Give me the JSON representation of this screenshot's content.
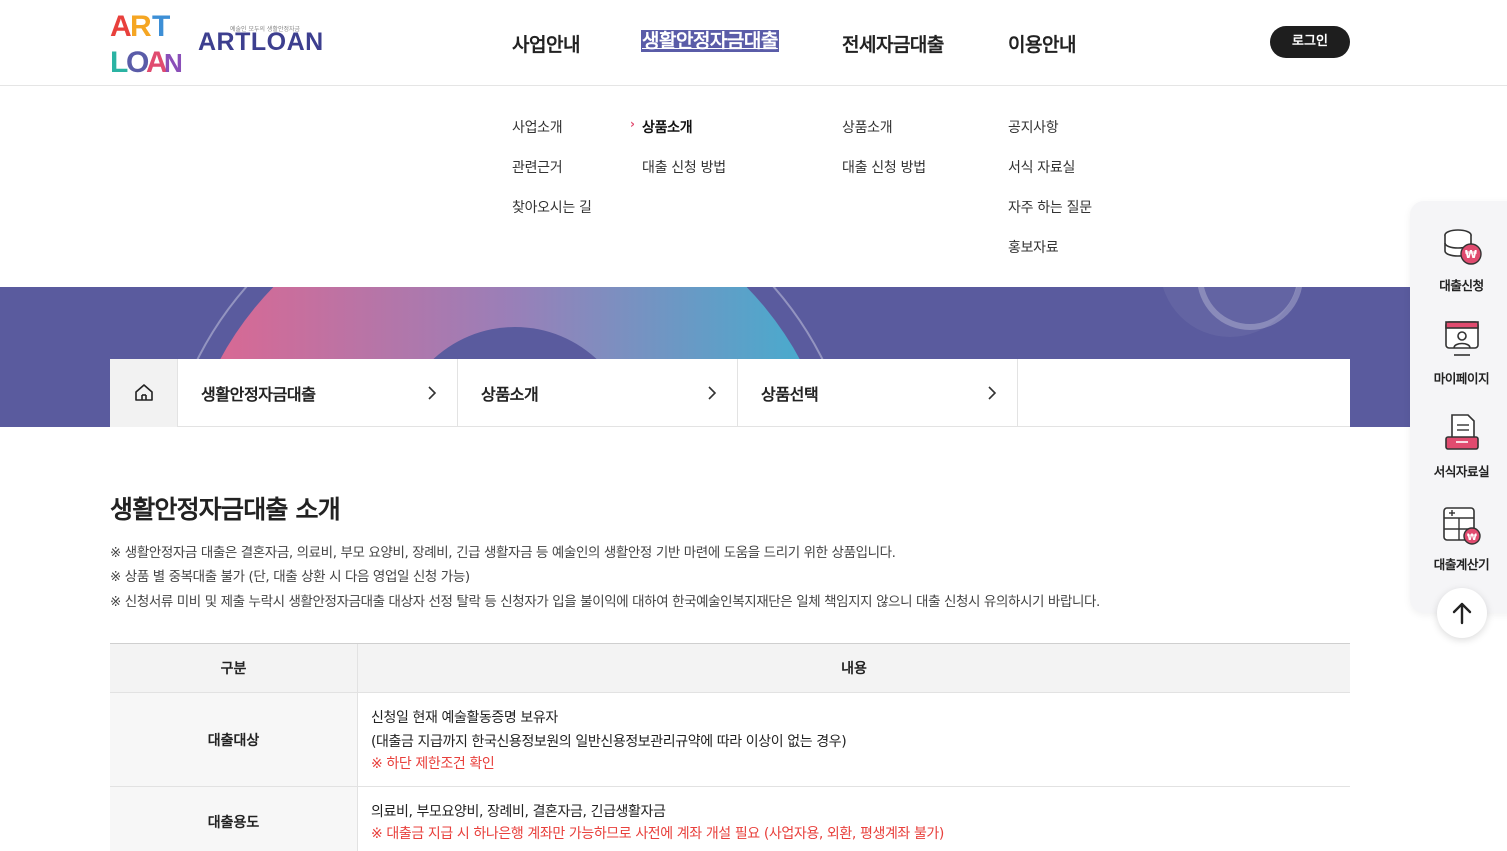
{
  "logo": {
    "tagline": "예술인 모두의 생활안정자금",
    "name": "ARTLOAN"
  },
  "gnb": [
    {
      "label": "사업안내"
    },
    {
      "label": "생활안정자금대출"
    },
    {
      "label": "전세자금대출"
    },
    {
      "label": "이용안내"
    }
  ],
  "login_label": "로그인",
  "submenu": {
    "col1": [
      "사업소개",
      "관련근거",
      "찾아오시는 길"
    ],
    "col2": [
      "상품소개",
      "대출 신청 방법"
    ],
    "col3": [
      "상품소개",
      "대출 신청 방법"
    ],
    "col4": [
      "공지사항",
      "서식 자료실",
      "자주 하는 질문",
      "홍보자료"
    ],
    "active_marker": "›"
  },
  "breadcrumb": [
    "생활안정자금대출",
    "상품소개",
    "상품선택"
  ],
  "page_title": "생활안정자금대출 소개",
  "notes": [
    "※ 생활안정자금 대출은 결혼자금, 의료비, 부모 요양비, 장례비, 긴급 생활자금 등 예술인의 생활안정 기반 마련에 도움을 드리기 위한 상품입니다.",
    "※ 상품 별 중복대출 불가 (단, 대출 상환 시 다음 영업일 신청 가능)",
    "※ 신청서류 미비 및 제출 누락시 생활안정자금대출 대상자 선정 탈락 등 신청자가 입을 불이익에 대하여 한국예술인복지재단은 일체 책임지지 않으니 대출 신청시 유의하시기 바랍니다."
  ],
  "table": {
    "headers": [
      "구분",
      "내용"
    ],
    "rows": [
      {
        "label": "대출대상",
        "lines": [
          "신청일 현재 예술활동증명 보유자",
          "(대출금 지급까지 한국신용정보원의 일반신용정보관리규약에 따라 이상이 없는 경우)"
        ],
        "warning": "※ 하단 제한조건 확인"
      },
      {
        "label": "대출용도",
        "lines": [
          "의료비, 부모요양비, 장례비, 결혼자금, 긴급생활자금"
        ],
        "warning": "※ 대출금 지급 시 하나은행 계좌만 가능하므로 사전에 계좌 개설 필요 (사업자용, 외환, 평생계좌 불가)"
      }
    ]
  },
  "quick_menu": [
    {
      "label": "대출신청",
      "icon": "loan-coin-icon"
    },
    {
      "label": "마이페이지",
      "icon": "mypage-icon"
    },
    {
      "label": "서식자료실",
      "icon": "document-tray-icon"
    },
    {
      "label": "대출계산기",
      "icon": "calculator-icon"
    }
  ],
  "colors": {
    "brand_purple": "#5a5b9e",
    "accent_red": "#e8403c",
    "accent_pink": "#e04b6f"
  }
}
